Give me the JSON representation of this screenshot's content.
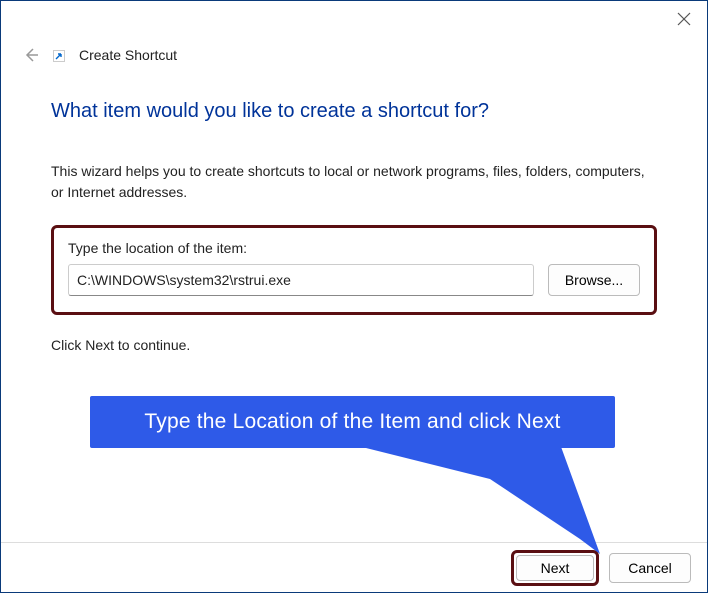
{
  "header": {
    "page_title": "Create Shortcut"
  },
  "main": {
    "heading": "What item would you like to create a shortcut for?",
    "description": "This wizard helps you to create shortcuts to local or network programs, files, folders, computers, or Internet addresses.",
    "input_label": "Type the location of the item:",
    "location_value": "C:\\WINDOWS\\system32\\rstrui.exe",
    "browse_label": "Browse...",
    "continue_text": "Click Next to continue."
  },
  "callout": {
    "text": "Type the Location of the Item and click Next"
  },
  "footer": {
    "next_label": "Next",
    "cancel_label": "Cancel"
  }
}
